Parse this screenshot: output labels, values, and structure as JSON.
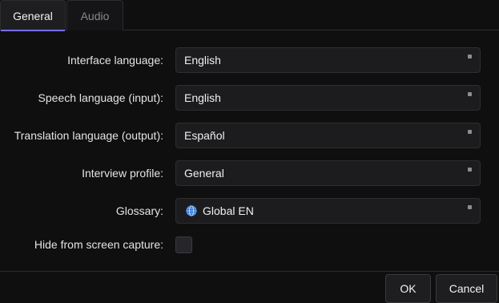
{
  "tabs": [
    {
      "label": "General",
      "active": true
    },
    {
      "label": "Audio",
      "active": false
    }
  ],
  "form": {
    "interface_language": {
      "label": "Interface language:",
      "value": "English"
    },
    "speech_language": {
      "label": "Speech language (input):",
      "value": "English"
    },
    "translation_language": {
      "label": "Translation language (output):",
      "value": "Español"
    },
    "interview_profile": {
      "label": "Interview profile:",
      "value": "General"
    },
    "glossary": {
      "label": "Glossary:",
      "value": "Global EN",
      "icon": "globe-icon"
    },
    "hide_from_capture": {
      "label": "Hide from screen capture:",
      "checked": false
    }
  },
  "buttons": {
    "ok": "OK",
    "cancel": "Cancel"
  },
  "colors": {
    "background": "#0f0f10",
    "accent": "#7a6cf0",
    "field": "#1c1c1f",
    "border": "#2e2e32",
    "text": "#e6e6e6",
    "muted_text": "#8a8a8e"
  }
}
